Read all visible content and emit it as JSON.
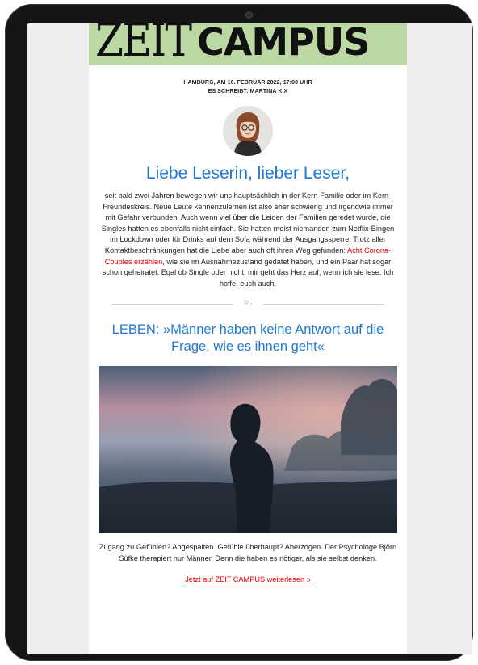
{
  "masthead": {
    "brand_zeit": "ZEIT",
    "brand_campus": "CAMPUS",
    "bg_color": "#bcd9a4"
  },
  "meta": {
    "dateline": "HAMBURG, AM 16. FEBRUAR 2022, 17:00 UHR",
    "author": "ES SCHREIBT: MARTINA KIX"
  },
  "greeting": "Liebe Leserin, lieber Leser,",
  "intro": {
    "text_before": "seit bald zwei Jahren bewegen wir uns hauptsächlich in der Kern-Familie oder im Kern-Freundeskreis. Neue Leute kennenzulernen ist also eher schwierig und irgendwie immer mit Gefahr verbunden. Auch wenn viel über die Leiden der Familien geredet wurde, die Singles hatten es ebenfalls nicht einfach. Sie hatten meist niemanden zum Netflix-Bingen im Lockdown oder für Drinks auf dem Sofa während der Ausgangssperre. Trotz aller Kontaktbeschränkungen hat die Liebe aber auch oft ihren Weg gefunden: ",
    "link_text": "Acht Corona-Couples erzählen",
    "text_after": ", wie sie im Ausnahmezustand gedatet haben, und ein Paar hat sogar schon geheiratet. Egal ob Single oder nicht, mir geht das Herz auf, wenn ich sie lese. Ich hoffe, euch auch."
  },
  "divider_icon": "sparkle-icon",
  "article": {
    "headline": "LEBEN: »Männer haben keine Antwort auf die Frage, wie es ihnen geht«",
    "teaser": "Zugang zu Gefühlen? Abgespalten. Gefühle überhaupt? Aberzogen. Der Psychologe Björn Süfke therapiert nur Männer. Denn die haben es nötiger, als sie selbst denken.",
    "cta": "Jetzt auf ZEIT CAMPUS weiterlesen »"
  },
  "colors": {
    "link_red": "#e00000",
    "headline_blue": "#1f78d1"
  }
}
